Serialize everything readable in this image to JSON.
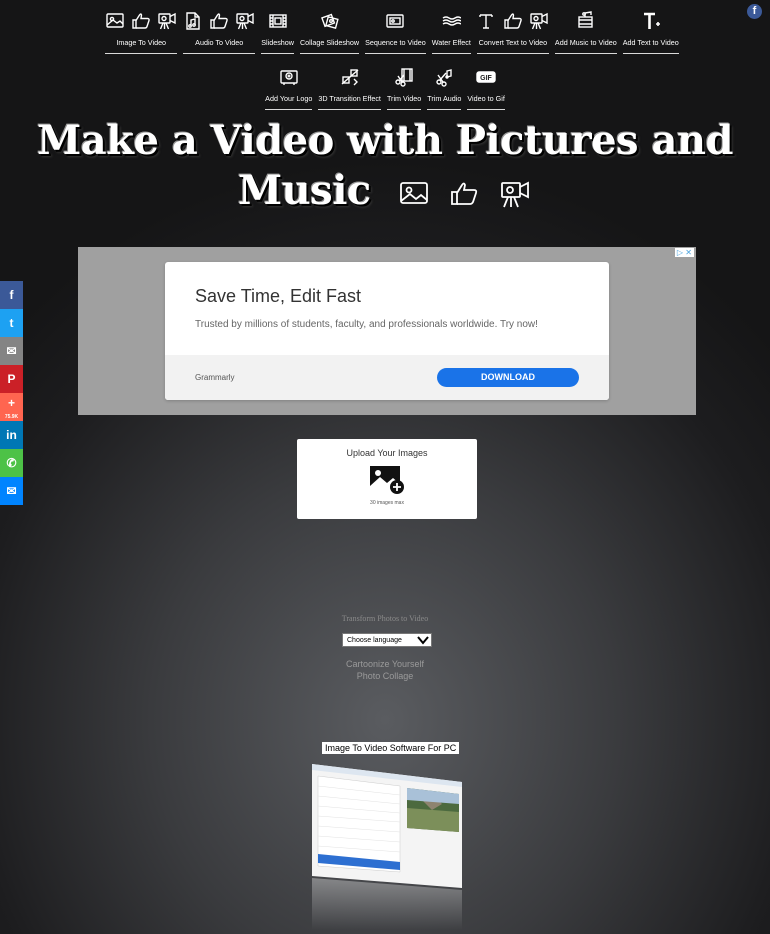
{
  "nav": {
    "row1": [
      {
        "label": "Image To Video",
        "icons": [
          "image-icon",
          "thumbs-up-icon",
          "video-camera-icon"
        ]
      },
      {
        "label": "Audio To Video",
        "icons": [
          "audio-file-icon",
          "thumbs-up-icon",
          "video-camera-icon"
        ]
      },
      {
        "label": "Slideshow",
        "icons": [
          "film-strip-icon"
        ]
      },
      {
        "label": "Collage Slideshow",
        "icons": [
          "collage-icon"
        ]
      },
      {
        "label": "Sequence to Video",
        "icons": [
          "sequence-icon"
        ]
      },
      {
        "label": "Water Effect",
        "icons": [
          "water-icon"
        ]
      },
      {
        "label": "Convert Text to Video",
        "icons": [
          "text-icon",
          "thumbs-up-icon",
          "video-camera-icon"
        ]
      },
      {
        "label": "Add Music to Video",
        "icons": [
          "music-film-icon"
        ]
      },
      {
        "label": "Add Text to Video",
        "icons": [
          "text-plus-icon"
        ]
      }
    ],
    "row2": [
      {
        "label": "Add Your Logo",
        "icons": [
          "logo-icon"
        ]
      },
      {
        "label": "3D Transition Effect",
        "icons": [
          "transition-icon"
        ]
      },
      {
        "label": "Trim Video",
        "icons": [
          "trim-video-icon"
        ]
      },
      {
        "label": "Trim Audio",
        "icons": [
          "trim-audio-icon"
        ]
      },
      {
        "label": "Video to Gif",
        "icons": [
          "gif-icon"
        ]
      }
    ]
  },
  "page_title_line1": "Make a Video with Pictures and",
  "page_title_line2": "Music",
  "share": {
    "count": "75.9K",
    "buttons": [
      {
        "name": "facebook",
        "color": "#3b5998",
        "glyph": "f"
      },
      {
        "name": "twitter",
        "color": "#1da1f2",
        "glyph": "t"
      },
      {
        "name": "email",
        "color": "#848484",
        "glyph": "✉"
      },
      {
        "name": "pinterest",
        "color": "#cb2027",
        "glyph": "P"
      },
      {
        "name": "more",
        "color": "#ff6550",
        "glyph": "+"
      },
      {
        "name": "linkedin",
        "color": "#0077b5",
        "glyph": "in"
      },
      {
        "name": "whatsapp",
        "color": "#4dc247",
        "glyph": "✆"
      },
      {
        "name": "messenger",
        "color": "#0084ff",
        "glyph": "✉"
      }
    ]
  },
  "ad": {
    "headline": "Save Time, Edit Fast",
    "subtext": "Trusted by millions of students, faculty, and professionals worldwide. Try now!",
    "advertiser": "Grammarly",
    "cta": "DOWNLOAD"
  },
  "upload": {
    "title": "Upload Your Images",
    "max": "30 images max"
  },
  "tagline": "Transform Photos to Video",
  "language_select": "Choose language",
  "links": [
    "Cartoonize Yourself",
    "Photo Collage"
  ],
  "software_label": "Image To Video Software For PC",
  "colors": {
    "accent_ad": "#1a73e8",
    "facebook": "#3b5998"
  }
}
